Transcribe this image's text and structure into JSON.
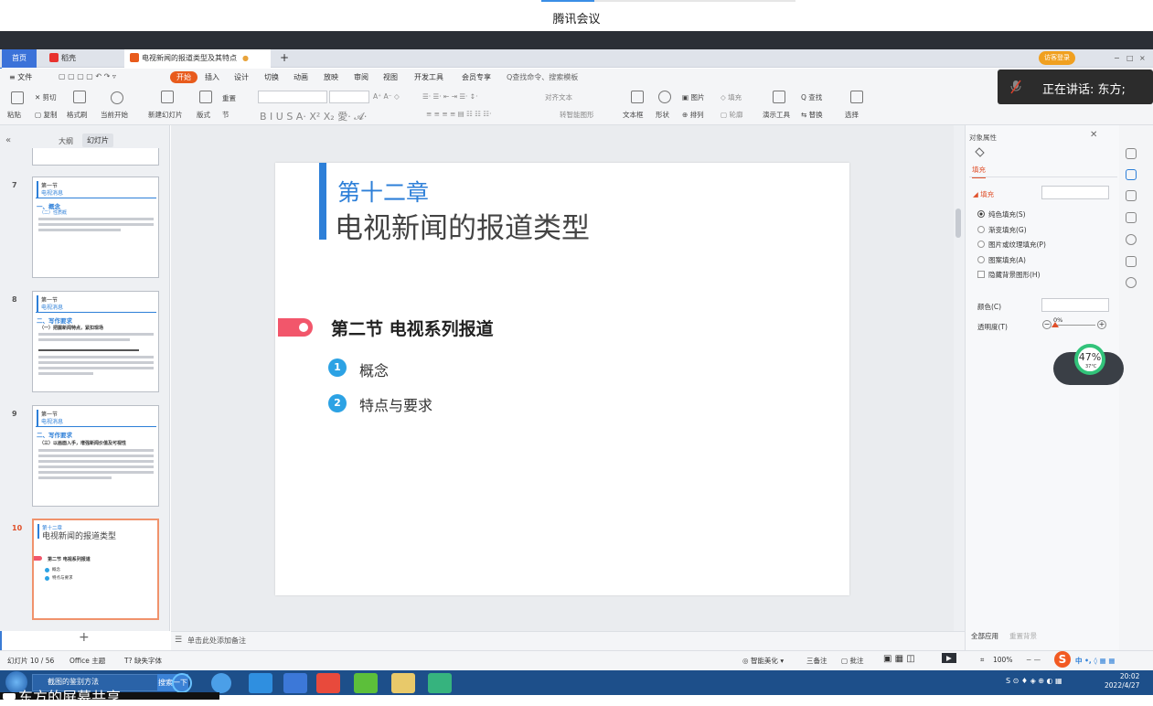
{
  "meeting": {
    "title": "腾讯会议",
    "speaking": "正在讲话: 东方;"
  },
  "tabs": {
    "home": "首页",
    "daoke": "稻壳",
    "doc": "电视新闻的报道类型及其特点"
  },
  "window": {
    "guest_login": "访客登录"
  },
  "menu": {
    "file": "≡ 文件",
    "start": "开始",
    "insert": "插入",
    "design": "设计",
    "transition": "切换",
    "animation": "动画",
    "show": "放映",
    "review": "审阅",
    "view": "视图",
    "dev": "开发工具",
    "member": "会员专享",
    "search": "Q查找命令、搜索模板"
  },
  "ribbon": {
    "paste": "粘贴",
    "cut": "剪切",
    "copy": "复制",
    "format_painter": "格式刷",
    "play_from_current": "当前开始",
    "new_slide": "新建幻灯片",
    "layout": "版式",
    "section": "节",
    "reset": "重置",
    "textbox": "文本框",
    "shape": "形状",
    "arrange": "排列",
    "picture": "图片",
    "outline": "轮廓",
    "fill": "填充",
    "present_tools": "演示工具",
    "find": "查找",
    "replace": "替换",
    "select": "选择",
    "align_text": "对齐文本",
    "smart_shape": "转智能图形"
  },
  "left_panel": {
    "outline_tab": "大纲",
    "slides_tab": "幻灯片",
    "slides": [
      {
        "num": "7",
        "t1": "第一节",
        "t2": "电视消息",
        "head": "一、概念",
        "sub": "（二）性质概"
      },
      {
        "num": "8",
        "t1": "第一节",
        "t2": "电视消息",
        "head": "二、写作要求",
        "sub": "（一）把握新闻特点，紧扣现场"
      },
      {
        "num": "9",
        "t1": "第一节",
        "t2": "电视消息",
        "head": "二、写作要求",
        "sub": "（三）以画面入手，增强新闻价值及可视性"
      },
      {
        "num": "10",
        "t1": "第十二章",
        "t2": "电视新闻的报道类型",
        "sec": "第二节 电视系列报道",
        "b1": "概念",
        "b2": "特点与要求"
      }
    ]
  },
  "slide": {
    "chapter": "第十二章",
    "title": "电视新闻的报道类型",
    "section": "第二节 电视系列报道",
    "bullets": [
      {
        "num": "1",
        "text": "概念"
      },
      {
        "num": "2",
        "text": "特点与要求"
      }
    ]
  },
  "notes": {
    "placeholder": "单击此处添加备注"
  },
  "right_panel": {
    "title": "对象属性",
    "tab_fill": "填充",
    "fill_label": "填充",
    "options": [
      "纯色填充(S)",
      "渐变填充(G)",
      "图片或纹理填充(P)",
      "图案填充(A)"
    ],
    "hide_bg": "隐藏背景图形(H)",
    "color_label": "颜色(C)",
    "trans_label": "透明度(T)",
    "trans_value": "0%",
    "apply_all": "全部应用",
    "reset_bg": "重置背景"
  },
  "gadget": {
    "percent": "47%",
    "temp": "37°C"
  },
  "status": {
    "slide_count": "幻灯片 10 / 56",
    "theme": "Office 主题",
    "missing_font": "缺失字体",
    "smart": "智能美化",
    "notes": "三备注",
    "comment": "批注",
    "zoom": "100%"
  },
  "taskbar": {
    "browser": "截图的鉴别方法",
    "search_btn": "搜索一下",
    "time": "20:02",
    "date": "2022/4/27"
  },
  "share": {
    "text": "东方的屏幕共享"
  },
  "colors": {
    "accent": "#2d7fd8",
    "brand_orange": "#e85b1c",
    "bullet": "#2ca2e4",
    "pill": "#f2566b"
  }
}
